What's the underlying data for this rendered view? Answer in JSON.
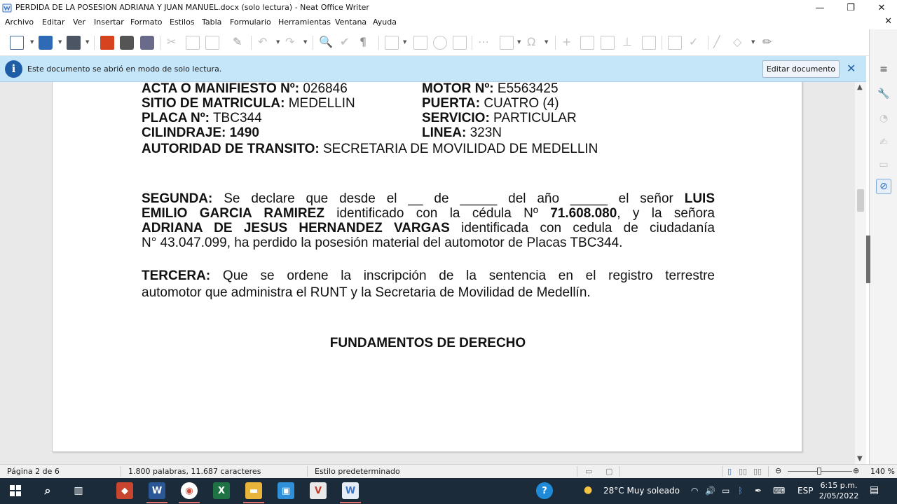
{
  "window": {
    "title": "PERDIDA DE LA POSESION ADRIANA Y JUAN MANUEL.docx (solo lectura) - Neat Office Writer",
    "minimize": "—",
    "restore": "❐",
    "close": "✕"
  },
  "menu": {
    "items": [
      "Archivo",
      "Editar",
      "Ver",
      "Insertar",
      "Formato",
      "Estilos",
      "Tabla",
      "Formulario",
      "Herramientas",
      "Ventana",
      "Ayuda"
    ],
    "close_doc": "✕"
  },
  "infobar": {
    "icon": "i",
    "message": "Este documento se abrió en modo de solo lectura.",
    "edit_button": "Editar documento",
    "close": "✕"
  },
  "document": {
    "rows": [
      {
        "left_label": "ACTA O MANIFIESTO Nº:",
        "left_value": " 026846",
        "right_label": "MOTOR Nº:",
        "right_value": " E5563425"
      },
      {
        "left_label": "SITIO DE MATRICULA:",
        "left_value": " MEDELLIN",
        "right_label": "PUERTA:",
        "right_value": " CUATRO (4)"
      },
      {
        "left_label": "PLACA Nº:",
        "left_value": " TBC344",
        "right_label": "SERVICIO:",
        "right_value": " PARTICULAR"
      },
      {
        "left_label": "CILINDRAJE: 1490",
        "left_value": "",
        "right_label": "LINEA:",
        "right_value": " 323N"
      }
    ],
    "authority_label": "AUTORIDAD DE TRANSITO:",
    "authority_value": " SECRETARIA DE MOVILIDAD DE MEDELLIN",
    "segunda": {
      "l1_label": "SEGUNDA:",
      "l1_text": " Se declare que desde el __ de _____ del año _____ el señor ",
      "l1_bold": "LUIS",
      "l2_bold": "EMILIO GARCIA RAMIREZ",
      "l2_text": " identificado con la cédula Nº ",
      "l2_bold2": "71.608.080",
      "l2_text2": ", y la señora",
      "l3_bold": "ADRIANA DE JESUS HERNANDEZ VARGAS",
      "l3_text": " identificada con cedula de ciudadanía",
      "l4_text": "N° 43.047.099, ha perdido la posesión material del automotor de Placas TBC344."
    },
    "tercera": {
      "l1_label": "TERCERA:",
      "l1_text": "  Que se ordene la inscripción de la sentencia en el registro terrestre",
      "l2_text": "automotor que administra el RUNT y la Secretaria de Movilidad de Medellín."
    },
    "heading": "FUNDAMENTOS DE DERECHO"
  },
  "status": {
    "page": "Página 2 de 6",
    "words": "1.800 palabras, 11.687 caracteres",
    "style": "Estilo predeterminado",
    "zoom": "140 %",
    "zoom_minus": "⊖",
    "zoom_plus": "⊕"
  },
  "taskbar": {
    "weather": "28°C  Muy soleado",
    "language": "ESP",
    "time": "6:15 p.m.",
    "date": "2/05/2022"
  },
  "colors": {
    "infobar_bg": "#c5e5f8",
    "info_icon": "#1d5ea7",
    "taskbar_bg": "#1c2b3a",
    "doc_bg": "#e9e9e9"
  }
}
